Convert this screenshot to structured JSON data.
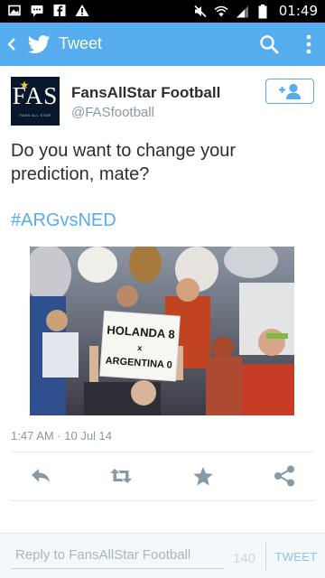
{
  "status_bar": {
    "time": "01:49",
    "left_icons": [
      "image-icon",
      "chat-bubble-icon",
      "facebook-icon",
      "warning-icon"
    ],
    "right_icons": [
      "mute-icon",
      "wifi-icon",
      "signal-icon",
      "battery-icon"
    ]
  },
  "app_bar": {
    "title": "Tweet",
    "color": "#55acee",
    "icons": [
      "back-arrow-icon",
      "twitter-bird-icon",
      "search-icon",
      "overflow-menu-icon"
    ]
  },
  "tweet": {
    "author": {
      "name": "FansAllStar Football",
      "handle": "@FASfootball",
      "avatar_text": "FAS",
      "avatar_subtext": "FANS ALL STAR"
    },
    "follow_icon": "follow-user-icon",
    "text": "Do you want to change your prediction, mate?",
    "hashtag": "#ARGvsNED",
    "photo": {
      "sign_line1": "HOLANDA 8",
      "sign_line2": "x",
      "sign_line3": "ARGENTINA 0"
    },
    "timestamp": "1:47 AM · 10 Jul 14",
    "actions": [
      "reply-icon",
      "retweet-icon",
      "favorite-icon",
      "share-icon"
    ]
  },
  "reply_bar": {
    "placeholder": "Reply to FansAllStar Football",
    "char_count": "140",
    "button_label": "TWEET"
  },
  "colors": {
    "accent": "#55acee",
    "text": "#292f33",
    "muted": "#8899a6",
    "action_icons": "#8899a6",
    "favorite_star": "#aab8c2"
  }
}
